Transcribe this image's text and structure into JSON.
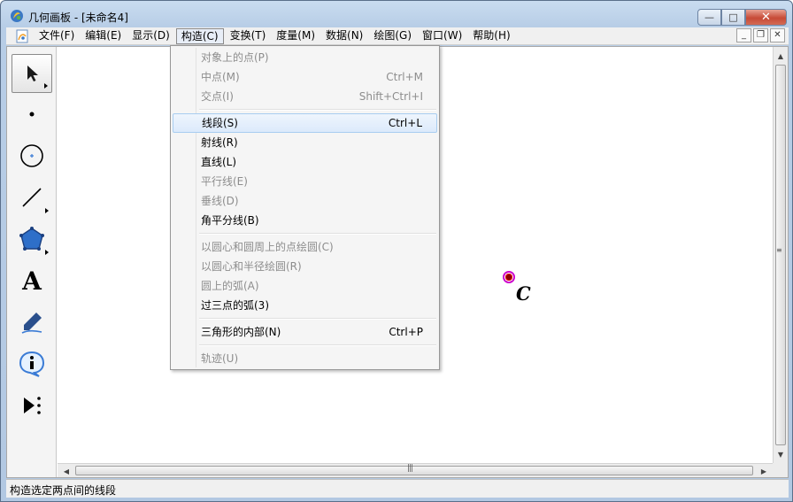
{
  "window": {
    "title": "几何画板 - [未命名4]",
    "minimize_glyph": "—",
    "maximize_glyph": "□",
    "close_glyph": "✕"
  },
  "menubar": {
    "items": [
      {
        "label": "文件(F)"
      },
      {
        "label": "编辑(E)"
      },
      {
        "label": "显示(D)"
      },
      {
        "label": "构造(C)"
      },
      {
        "label": "变换(T)"
      },
      {
        "label": "度量(M)"
      },
      {
        "label": "数据(N)"
      },
      {
        "label": "绘图(G)"
      },
      {
        "label": "窗口(W)"
      },
      {
        "label": "帮助(H)"
      }
    ],
    "mdi_min": "_",
    "mdi_restore": "❐",
    "mdi_close": "✕"
  },
  "construct_menu": {
    "items": [
      {
        "label": "对象上的点(P)",
        "shortcut": ""
      },
      {
        "label": "中点(M)",
        "shortcut": "Ctrl+M"
      },
      {
        "label": "交点(I)",
        "shortcut": "Shift+Ctrl+I"
      },
      {
        "label": "线段(S)",
        "shortcut": "Ctrl+L"
      },
      {
        "label": "射线(R)",
        "shortcut": ""
      },
      {
        "label": "直线(L)",
        "shortcut": ""
      },
      {
        "label": "平行线(E)",
        "shortcut": ""
      },
      {
        "label": "垂线(D)",
        "shortcut": ""
      },
      {
        "label": "角平分线(B)",
        "shortcut": ""
      },
      {
        "label": "以圆心和圆周上的点绘圆(C)",
        "shortcut": ""
      },
      {
        "label": "以圆心和半径绘圆(R)",
        "shortcut": ""
      },
      {
        "label": "圆上的弧(A)",
        "shortcut": ""
      },
      {
        "label": "过三点的弧(3)",
        "shortcut": ""
      },
      {
        "label": "三角形的内部(N)",
        "shortcut": "Ctrl+P"
      },
      {
        "label": "轨迹(U)",
        "shortcut": ""
      }
    ]
  },
  "canvas": {
    "point_label": "C"
  },
  "toolbox": {
    "text_tool_glyph": "A"
  },
  "statusbar": {
    "text": "构造选定两点间的线段"
  }
}
